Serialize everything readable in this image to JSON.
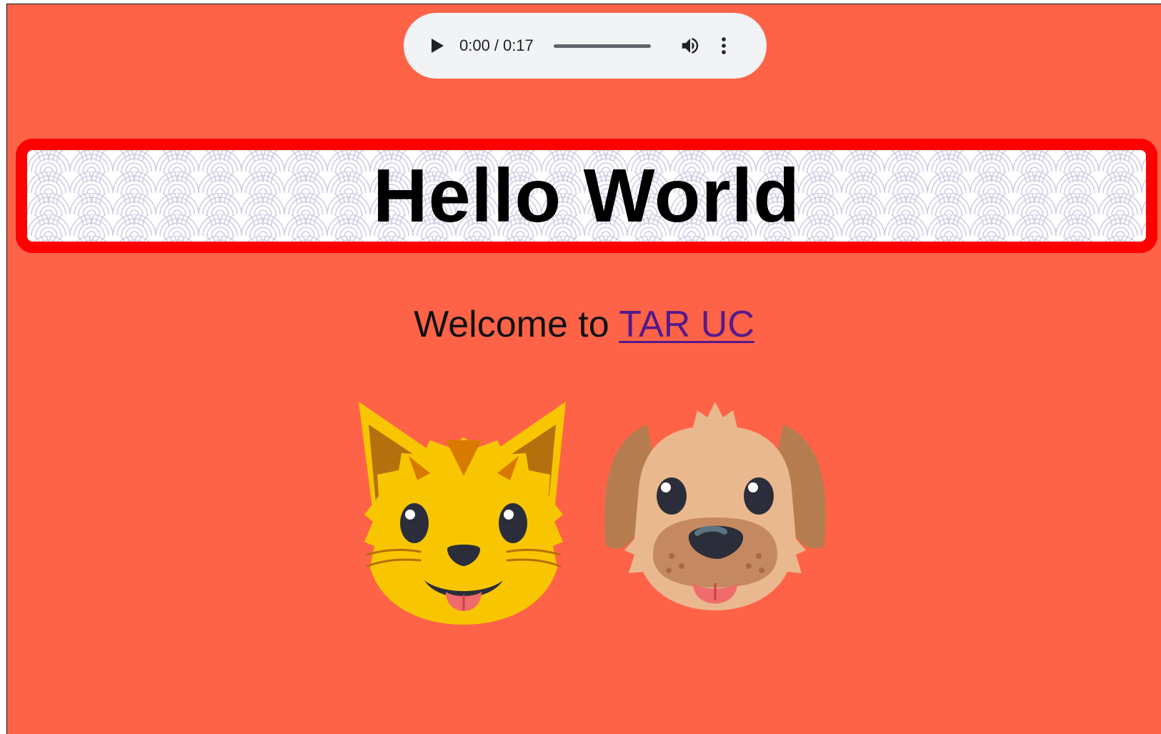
{
  "audio_player": {
    "current_time": "0:00",
    "separator": "/",
    "duration": "0:17",
    "progress": 0,
    "icons": {
      "play": "play-icon",
      "volume": "volume-icon",
      "menu": "more-vertical-icon"
    }
  },
  "banner": {
    "title": "Hello World",
    "border_color": "#ff0000"
  },
  "welcome": {
    "prefix": "Welcome to ",
    "link_text": "TAR UC",
    "link_color": "#551a8b"
  },
  "images": {
    "cat": "cat-face-emoji",
    "dog": "dog-face-emoji"
  },
  "colors": {
    "page_background": "#ff6347",
    "player_background": "#f1f3f4"
  }
}
